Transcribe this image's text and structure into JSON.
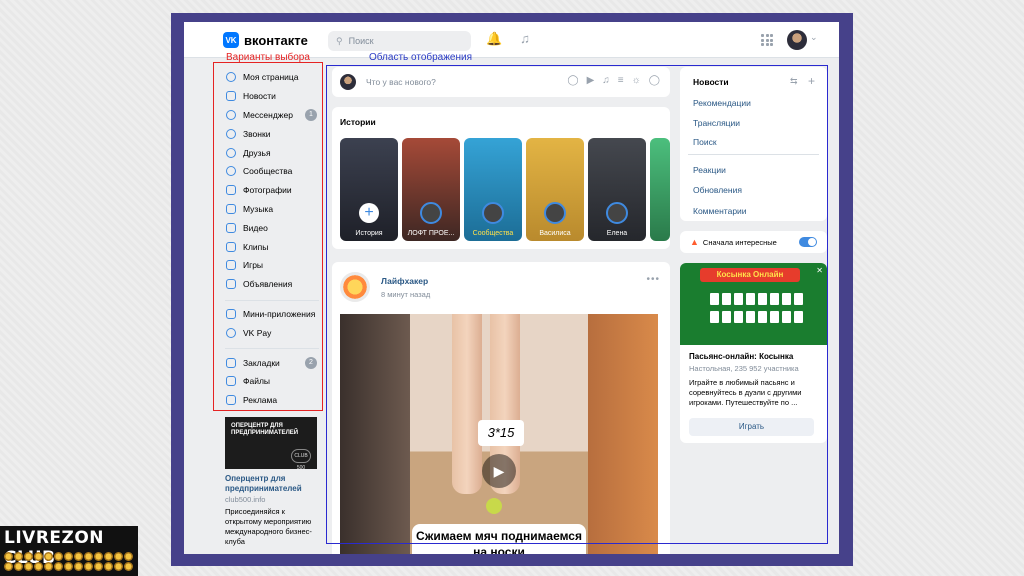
{
  "header": {
    "logo_text": "вконтакте",
    "logo_mark": "VK",
    "search_placeholder": "Поиск"
  },
  "annotations": {
    "left_label": "Варианты выбора",
    "right_label": "Область отображения",
    "left_color": "#e52323",
    "right_color": "#2a3bc4"
  },
  "sidebar": {
    "items": [
      {
        "label": "Моя страница",
        "icon": "user-icon"
      },
      {
        "label": "Новости",
        "icon": "news-icon"
      },
      {
        "label": "Мессенджер",
        "icon": "chat-icon",
        "badge": "1"
      },
      {
        "label": "Звонки",
        "icon": "phone-icon"
      },
      {
        "label": "Друзья",
        "icon": "friends-icon"
      },
      {
        "label": "Сообщества",
        "icon": "communities-icon"
      },
      {
        "label": "Фотографии",
        "icon": "photo-icon"
      },
      {
        "label": "Музыка",
        "icon": "music-icon"
      },
      {
        "label": "Видео",
        "icon": "video-icon"
      },
      {
        "label": "Клипы",
        "icon": "clips-icon"
      },
      {
        "label": "Игры",
        "icon": "games-icon"
      },
      {
        "label": "Объявления",
        "icon": "ads-icon"
      }
    ],
    "items2": [
      {
        "label": "Мини-приложения",
        "icon": "apps-icon"
      },
      {
        "label": "VK Pay",
        "icon": "pay-icon"
      }
    ],
    "items3": [
      {
        "label": "Закладки",
        "icon": "bookmark-icon",
        "badge": "2"
      },
      {
        "label": "Файлы",
        "icon": "files-icon"
      },
      {
        "label": "Реклама",
        "icon": "megaphone-icon"
      }
    ]
  },
  "promo": {
    "image_text": "ОПЕРЦЕНТР ДЛЯ ПРЕДПРИНИМАТЕЛЕЙ",
    "club": "CLUB 500",
    "title": "Оперцентр для предпринимателей",
    "source": "club500.info",
    "text": "Присоединяйся к открытому мероприятию международного бизнес-клуба"
  },
  "composer": {
    "placeholder": "Что у вас нового?"
  },
  "stories": {
    "title": "Истории",
    "items": [
      {
        "name": "История",
        "color": "#2b2f3a"
      },
      {
        "name": "ЛОФТ ПРОЕ...",
        "color": "#4a2e2a"
      },
      {
        "name": "Сообщества",
        "color": "#2d8fbf"
      },
      {
        "name": "Василиса",
        "color": "#d8a43a"
      },
      {
        "name": "Елена",
        "color": "#3b3e46"
      },
      {
        "name": "",
        "color": "#3aa36a"
      }
    ]
  },
  "post": {
    "author": "Лайфхакер",
    "time": "8 минут назад",
    "video_note": "3*15",
    "caption": "Сжимаем мяч поднимаемся на носки"
  },
  "right_menu": {
    "items": [
      "Новости",
      "Рекомендации",
      "Трансляции",
      "Поиск"
    ],
    "items2": [
      "Реакции",
      "Обновления",
      "Комментарии"
    ]
  },
  "toggle": {
    "label": "Сначала интересные",
    "on": true
  },
  "ad": {
    "banner": "Косынка Онлайн",
    "title": "Пасьянс-онлайн: Косынка",
    "subtitle": "Настольная, 235 952 участника",
    "text": "Играйте в любимый пасьянс и соревнуйтесь в дуэли с другими игроками. Путешествуйте по ...",
    "button": "Играть"
  },
  "watermark": {
    "text": "LIVREZON CLUB"
  }
}
